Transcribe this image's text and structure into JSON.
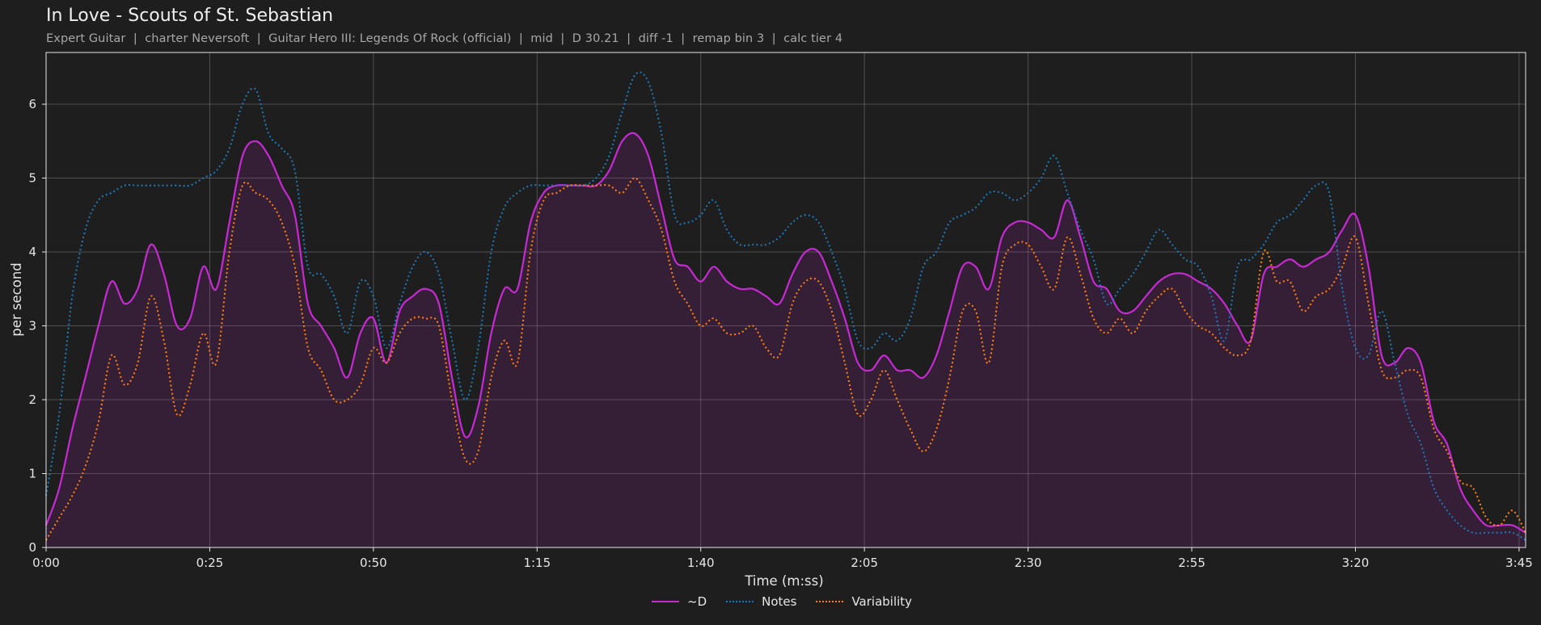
{
  "header": {
    "title": "In Love - Scouts of St. Sebastian",
    "subtitle": "Expert Guitar  |  charter Neversoft  |  Guitar Hero III: Legends Of Rock (official)  |  mid  |  D 30.21  |  diff -1  |  remap bin 3  |  calc tier 4"
  },
  "chart_data": {
    "type": "line",
    "xlabel": "Time (m:ss)",
    "ylabel": "per second",
    "xlim": [
      0,
      226
    ],
    "ylim": [
      0,
      6.7
    ],
    "x_ticks": [
      0,
      25,
      50,
      75,
      100,
      125,
      150,
      175,
      200,
      225
    ],
    "x_tick_labels": [
      "0:00",
      "0:25",
      "0:50",
      "1:15",
      "1:40",
      "2:05",
      "2:30",
      "2:55",
      "3:20",
      "3:45"
    ],
    "y_ticks": [
      0,
      1,
      2,
      3,
      4,
      5,
      6
    ],
    "y_tick_labels": [
      "0",
      "1",
      "2",
      "3",
      "4",
      "5",
      "6"
    ],
    "grid": true,
    "legend_position": "bottom-center",
    "x": [
      0,
      2,
      4,
      6,
      8,
      10,
      12,
      14,
      16,
      18,
      20,
      22,
      24,
      26,
      28,
      30,
      32,
      34,
      36,
      38,
      40,
      42,
      44,
      46,
      48,
      50,
      52,
      54,
      56,
      58,
      60,
      62,
      64,
      66,
      68,
      70,
      72,
      74,
      76,
      78,
      80,
      82,
      84,
      86,
      88,
      90,
      92,
      94,
      96,
      98,
      100,
      102,
      104,
      106,
      108,
      110,
      112,
      114,
      116,
      118,
      120,
      122,
      124,
      126,
      128,
      130,
      132,
      134,
      136,
      138,
      140,
      142,
      144,
      146,
      148,
      150,
      152,
      154,
      156,
      158,
      160,
      162,
      164,
      166,
      168,
      170,
      172,
      174,
      176,
      178,
      180,
      182,
      184,
      186,
      188,
      190,
      192,
      194,
      196,
      198,
      200,
      202,
      204,
      206,
      208,
      210,
      212,
      214,
      216,
      218,
      220,
      222,
      224,
      226
    ],
    "series": [
      {
        "name": "~D",
        "color": "#c62ad2",
        "style": "solid",
        "fill": true,
        "values": [
          0.3,
          0.8,
          1.6,
          2.3,
          3.0,
          3.6,
          3.3,
          3.5,
          4.1,
          3.7,
          3.0,
          3.1,
          3.8,
          3.5,
          4.4,
          5.3,
          5.5,
          5.3,
          4.9,
          4.5,
          3.3,
          3.0,
          2.7,
          2.3,
          2.9,
          3.1,
          2.5,
          3.2,
          3.4,
          3.5,
          3.3,
          2.3,
          1.5,
          1.9,
          2.9,
          3.5,
          3.5,
          4.4,
          4.8,
          4.9,
          4.9,
          4.9,
          4.9,
          5.1,
          5.5,
          5.6,
          5.3,
          4.6,
          3.9,
          3.8,
          3.6,
          3.8,
          3.6,
          3.5,
          3.5,
          3.4,
          3.3,
          3.7,
          4.0,
          4.0,
          3.6,
          3.1,
          2.5,
          2.4,
          2.6,
          2.4,
          2.4,
          2.3,
          2.6,
          3.2,
          3.8,
          3.8,
          3.5,
          4.2,
          4.4,
          4.4,
          4.3,
          4.2,
          4.7,
          4.2,
          3.6,
          3.5,
          3.2,
          3.2,
          3.4,
          3.6,
          3.7,
          3.7,
          3.6,
          3.5,
          3.3,
          3.0,
          2.8,
          3.7,
          3.8,
          3.9,
          3.8,
          3.9,
          4.0,
          4.3,
          4.5,
          3.8,
          2.6,
          2.5,
          2.7,
          2.5,
          1.7,
          1.4,
          0.8,
          0.5,
          0.3,
          0.3,
          0.3,
          0.2
        ]
      },
      {
        "name": "Notes",
        "color": "#1f77b4",
        "style": "dotted",
        "values": [
          0.7,
          1.8,
          3.4,
          4.3,
          4.7,
          4.8,
          4.9,
          4.9,
          4.9,
          4.9,
          4.9,
          4.9,
          5.0,
          5.1,
          5.4,
          6.0,
          6.2,
          5.6,
          5.4,
          5.1,
          3.8,
          3.7,
          3.4,
          2.9,
          3.6,
          3.4,
          2.7,
          3.3,
          3.8,
          4.0,
          3.7,
          2.8,
          2.0,
          2.7,
          4.0,
          4.6,
          4.8,
          4.9,
          4.9,
          4.9,
          4.9,
          4.9,
          5.0,
          5.3,
          5.9,
          6.4,
          6.3,
          5.6,
          4.5,
          4.4,
          4.5,
          4.7,
          4.3,
          4.1,
          4.1,
          4.1,
          4.2,
          4.4,
          4.5,
          4.4,
          4.0,
          3.5,
          2.8,
          2.7,
          2.9,
          2.8,
          3.1,
          3.8,
          4.0,
          4.4,
          4.5,
          4.6,
          4.8,
          4.8,
          4.7,
          4.8,
          5.0,
          5.3,
          4.8,
          4.3,
          3.9,
          3.3,
          3.5,
          3.7,
          4.0,
          4.3,
          4.1,
          3.9,
          3.8,
          3.4,
          2.8,
          3.8,
          3.9,
          4.1,
          4.4,
          4.5,
          4.7,
          4.9,
          4.8,
          3.5,
          2.7,
          2.6,
          3.2,
          2.5,
          1.8,
          1.4,
          0.8,
          0.5,
          0.3,
          0.2,
          0.2,
          0.2,
          0.2,
          0.1
        ]
      },
      {
        "name": "Variability",
        "color": "#ff7f0e",
        "style": "dotted",
        "values": [
          0.1,
          0.4,
          0.7,
          1.1,
          1.7,
          2.6,
          2.2,
          2.5,
          3.4,
          2.8,
          1.8,
          2.2,
          2.9,
          2.5,
          4.0,
          4.9,
          4.8,
          4.7,
          4.4,
          3.8,
          2.7,
          2.4,
          2.0,
          2.0,
          2.2,
          2.7,
          2.5,
          2.9,
          3.1,
          3.1,
          3.0,
          2.0,
          1.2,
          1.3,
          2.3,
          2.8,
          2.5,
          4.0,
          4.7,
          4.8,
          4.9,
          4.9,
          4.9,
          4.9,
          4.8,
          5.0,
          4.7,
          4.3,
          3.6,
          3.3,
          3.0,
          3.1,
          2.9,
          2.9,
          3.0,
          2.7,
          2.6,
          3.3,
          3.6,
          3.6,
          3.2,
          2.5,
          1.8,
          2.0,
          2.4,
          2.0,
          1.6,
          1.3,
          1.6,
          2.3,
          3.2,
          3.2,
          2.5,
          3.8,
          4.1,
          4.1,
          3.8,
          3.5,
          4.2,
          3.7,
          3.1,
          2.9,
          3.1,
          2.9,
          3.2,
          3.4,
          3.5,
          3.2,
          3.0,
          2.9,
          2.7,
          2.6,
          2.8,
          4.0,
          3.6,
          3.6,
          3.2,
          3.4,
          3.5,
          3.8,
          4.2,
          3.3,
          2.4,
          2.3,
          2.4,
          2.3,
          1.6,
          1.3,
          0.9,
          0.8,
          0.4,
          0.3,
          0.5,
          0.2
        ]
      }
    ]
  }
}
